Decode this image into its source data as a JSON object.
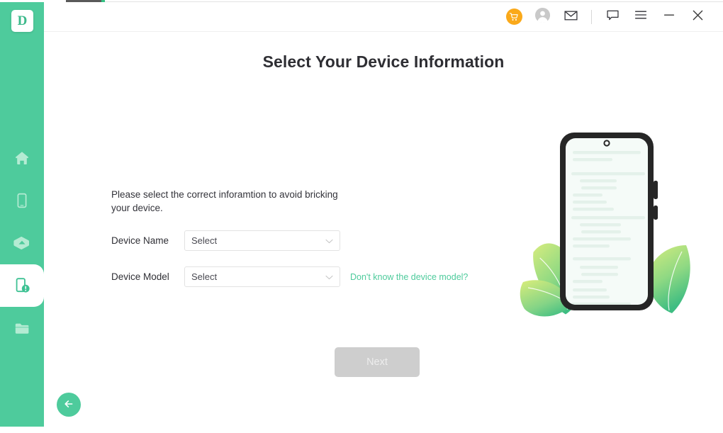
{
  "app": {
    "logo_letter": "D",
    "brand_color": "#4ecb9c"
  },
  "titlebar": {
    "icons": [
      {
        "name": "cart-icon",
        "glyph": "cart",
        "color": "#faa91a"
      },
      {
        "name": "account-icon",
        "glyph": "person",
        "color": "#c9c9c9"
      },
      {
        "name": "mail-icon",
        "glyph": "envelope",
        "color": "#2f2f35"
      },
      {
        "name": "feedback-icon",
        "glyph": "chat-bubble",
        "color": "#2f2f35"
      },
      {
        "name": "menu-icon",
        "glyph": "hamburger",
        "color": "#2f2f35"
      },
      {
        "name": "minimize-button",
        "glyph": "minus",
        "color": "#3a3a3a"
      },
      {
        "name": "close-button",
        "glyph": "cross",
        "color": "#3a3a3a"
      }
    ]
  },
  "sidebar": {
    "items": [
      {
        "name": "sidebar-item-home",
        "icon": "home-icon",
        "active": false
      },
      {
        "name": "sidebar-item-device",
        "icon": "phone-icon",
        "active": false
      },
      {
        "name": "sidebar-item-backup",
        "icon": "cloud-upload-icon",
        "active": false
      },
      {
        "name": "sidebar-item-system-repair",
        "icon": "phone-warning-icon",
        "active": true
      },
      {
        "name": "sidebar-item-files",
        "icon": "folder-icon",
        "active": false
      }
    ],
    "back_button": "back-arrow-icon"
  },
  "main": {
    "title": "Select Your Device Information",
    "hint": "Please select the correct inforamtion to avoid bricking your device.",
    "fields": [
      {
        "name": "device-name",
        "label": "Device Name",
        "value": "Select",
        "placeholder": "Select"
      },
      {
        "name": "device-model",
        "label": "Device Model",
        "value": "Select",
        "placeholder": "Select"
      }
    ],
    "help_link": "Don't know the device model?",
    "next_label": "Next",
    "next_enabled": false
  },
  "illustration": {
    "name": "phone-with-text-illustration",
    "phone_frame_color": "#262626",
    "phone_screen_color": "#f5fbf8",
    "screen_line_color": "#e3f1ea",
    "leaf_gradient_from": "#cdea7c",
    "leaf_gradient_to": "#45c080"
  }
}
